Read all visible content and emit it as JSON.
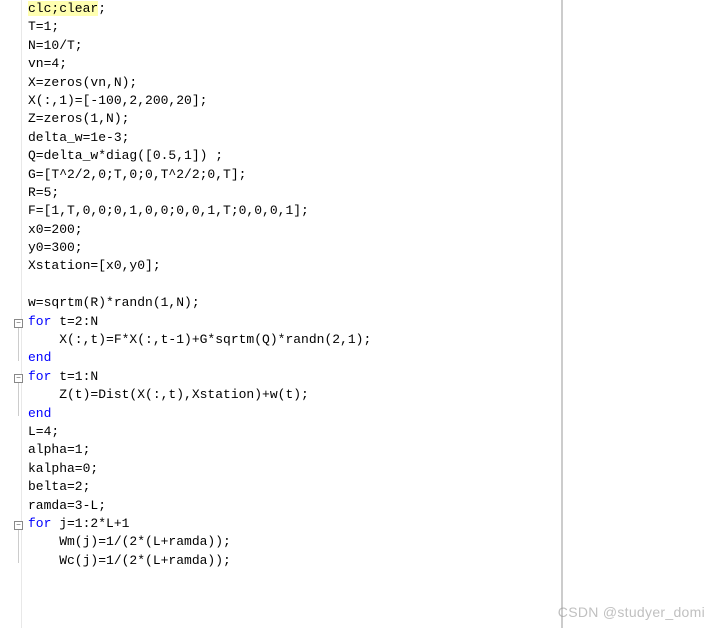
{
  "code": {
    "foldable_line_indices": [
      19,
      22,
      23,
      26,
      32
    ],
    "lines": [
      {
        "kw": "",
        "text": "clc;clear;",
        "hl_prefix_len": 9
      },
      {
        "kw": "",
        "text": "T=1;"
      },
      {
        "kw": "",
        "text": "N=10/T;"
      },
      {
        "kw": "",
        "text": "vn=4;"
      },
      {
        "kw": "",
        "text": "X=zeros(vn,N);"
      },
      {
        "kw": "",
        "text": "X(:,1)=[-100,2,200,20];"
      },
      {
        "kw": "",
        "text": "Z=zeros(1,N);"
      },
      {
        "kw": "",
        "text": "delta_w=1e-3;"
      },
      {
        "kw": "",
        "text": "Q=delta_w*diag([0.5,1]) ;"
      },
      {
        "kw": "",
        "text": "G=[T^2/2,0;T,0;0,T^2/2;0,T];"
      },
      {
        "kw": "",
        "text": "R=5;"
      },
      {
        "kw": "",
        "text": "F=[1,T,0,0;0,1,0,0;0,0,1,T;0,0,0,1];"
      },
      {
        "kw": "",
        "text": "x0=200;"
      },
      {
        "kw": "",
        "text": "y0=300;"
      },
      {
        "kw": "",
        "text": "Xstation=[x0,y0];"
      },
      {
        "kw": "",
        "text": ""
      },
      {
        "kw": "",
        "text": "w=sqrtm(R)*randn(1,N);"
      },
      {
        "kw": "for",
        "text": " t=2:N"
      },
      {
        "kw": "",
        "text": "    X(:,t)=F*X(:,t-1)+G*sqrtm(Q)*randn(2,1);"
      },
      {
        "kw": "end",
        "text": ""
      },
      {
        "kw": "for",
        "text": " t=1:N"
      },
      {
        "kw": "",
        "text": "    Z(t)=Dist(X(:,t),Xstation)+w(t);"
      },
      {
        "kw": "end",
        "text": ""
      },
      {
        "kw": "",
        "text": "L=4;"
      },
      {
        "kw": "",
        "text": "alpha=1;"
      },
      {
        "kw": "",
        "text": "kalpha=0;"
      },
      {
        "kw": "",
        "text": "belta=2;"
      },
      {
        "kw": "",
        "text": "ramda=3-L;"
      },
      {
        "kw": "for",
        "text": " j=1:2*L+1"
      },
      {
        "kw": "",
        "text": "    Wm(j)=1/(2*(L+ramda));"
      },
      {
        "kw": "",
        "text": "    Wc(j)=1/(2*(L+ramda));"
      }
    ]
  },
  "watermark": "CSDN @studyer_domi"
}
